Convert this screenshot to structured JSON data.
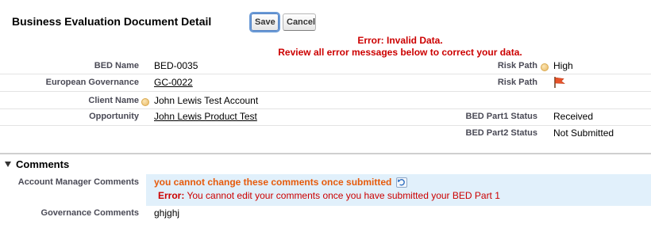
{
  "page": {
    "title": "Business Evaluation Document Detail"
  },
  "toolbar": {
    "save_label": "Save",
    "cancel_label": "Cancel"
  },
  "error_header": {
    "line1": "Error: Invalid Data.",
    "line2": "Review all error messages below to correct your data."
  },
  "fields": {
    "bed_name": {
      "label": "BED Name",
      "value": "BED-0035"
    },
    "european_governance": {
      "label": "European Governance",
      "value": "GC-0022"
    },
    "client_name": {
      "label": "Client Name",
      "value": "John Lewis Test Account"
    },
    "opportunity": {
      "label": "Opportunity",
      "value": "John Lewis Product Test"
    },
    "risk_path": {
      "label": "Risk Path",
      "value": "High"
    },
    "risk_path_flag": {
      "label": "Risk Path",
      "icon": "red-flag-icon",
      "color": "#e8532a"
    },
    "bed_part1_status": {
      "label": "BED Part1 Status",
      "value": "Received"
    },
    "bed_part2_status": {
      "label": "BED Part2 Status",
      "value": "Not Submitted"
    }
  },
  "comments_section": {
    "title": "Comments",
    "account_manager": {
      "label": "Account Manager Comments",
      "warning": "you cannot change these comments once submitted",
      "error_prefix": "Error:",
      "error_text": " You cannot edit your comments once you have submitted your BED Part 1"
    },
    "governance": {
      "label": "Governance Comments",
      "value": "ghjghj"
    }
  },
  "colors": {
    "error": "#cc0000",
    "warning": "#e65a0b",
    "highlight_bg": "#e1f0fb"
  }
}
